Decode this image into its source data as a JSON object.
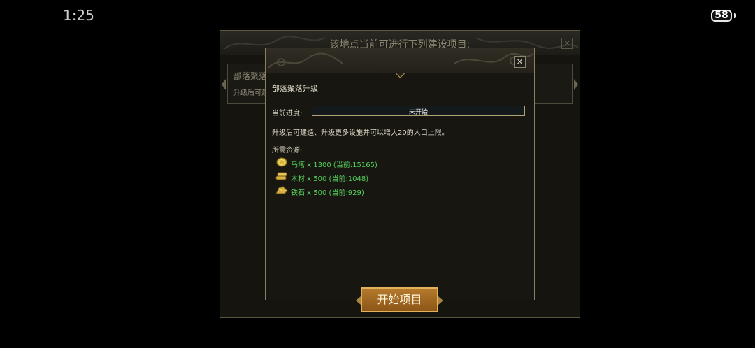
{
  "status_bar": {
    "time": "1:25",
    "battery": "58"
  },
  "outer_dialog": {
    "title": "该地点当前可进行下列建设项目:",
    "close_label": "×",
    "card": {
      "title": "部落聚落",
      "desc": "升级后可建"
    }
  },
  "dialog": {
    "close_label": "×",
    "title": "部落聚落升级",
    "progress_label": "当前进度:",
    "progress_status": "未开始",
    "progress_value": 0,
    "description": "升级后可建造、升级更多设施并可以增大20的人口上限。",
    "resources_label": "所需资源:",
    "resources": [
      {
        "icon": "coin-icon",
        "text": "乌塔 x 1300 (当前:15165)"
      },
      {
        "icon": "wood-icon",
        "text": "木材 x 500 (当前:1048)"
      },
      {
        "icon": "iron-ore-icon",
        "text": "铁石 x 500 (当前:929)"
      }
    ],
    "start_button_label": "开始项目"
  },
  "colors": {
    "resource_text": "#55d05b",
    "button_border": "#e2b25b",
    "button_fill": "#a26b25"
  }
}
